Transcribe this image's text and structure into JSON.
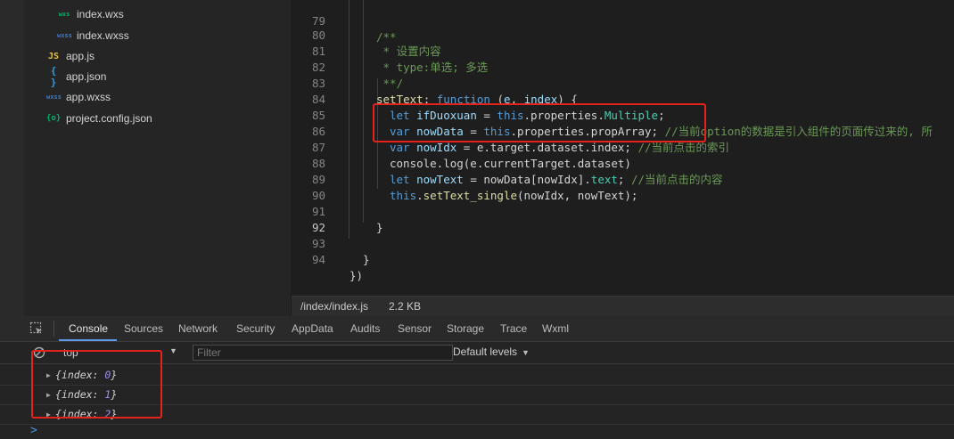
{
  "file_tree": {
    "items": [
      {
        "icon": "wxs-file-icon",
        "icon_text": "wxs",
        "label": "index.wxs"
      },
      {
        "icon": "wxss-file-icon",
        "icon_text": "wxss",
        "label": "index.wxss"
      },
      {
        "icon": "js-file-icon",
        "icon_text": "JS",
        "label": "app.js"
      },
      {
        "icon": "json-file-icon",
        "icon_text": "{ }",
        "label": "app.json"
      },
      {
        "icon": "wxss-file-icon",
        "icon_text": "wxss",
        "label": "app.wxss"
      },
      {
        "icon": "config-file-icon",
        "icon_text": "{o}",
        "label": "project.config.json"
      }
    ]
  },
  "editor": {
    "current_line": 92,
    "lines": [
      {
        "n": 79,
        "code": "/**"
      },
      {
        "n": 80,
        "code": " * 设置内容"
      },
      {
        "n": 81,
        "code": " * type:单选; 多选"
      },
      {
        "n": 82,
        "code": " **/"
      },
      {
        "n": 83,
        "code": "setText: function (e, index) {"
      },
      {
        "n": 84,
        "code": "  let ifDuoxuan = this.properties.Multiple;"
      },
      {
        "n": 85,
        "code": "  var nowData = this.properties.propArray; //当前option的数据是引入组件的页面传过来的, 所"
      },
      {
        "n": 86,
        "code": "  var nowIdx = e.target.dataset.index; //当前点击的索引"
      },
      {
        "n": 87,
        "code": "  console.log(e.currentTarget.dataset)"
      },
      {
        "n": 88,
        "code": "  let nowText = nowData[nowIdx].text; //当前点击的内容"
      },
      {
        "n": 89,
        "code": "  this.setText_single(nowIdx, nowText);"
      },
      {
        "n": 90,
        "code": ""
      },
      {
        "n": 91,
        "code": "}"
      },
      {
        "n": 92,
        "code": ""
      },
      {
        "n": 93,
        "code": "}"
      },
      {
        "n": 94,
        "code": "})"
      }
    ]
  },
  "status_bar": {
    "path": "/index/index.js",
    "size": "2.2 KB"
  },
  "devtools": {
    "tabs": [
      "Console",
      "Sources",
      "Network",
      "Security",
      "AppData",
      "Audits",
      "Sensor",
      "Storage",
      "Trace",
      "Wxml"
    ],
    "active_tab": "Console",
    "toolbar": {
      "context": "top",
      "filter_placeholder": "Filter",
      "levels": "Default levels"
    },
    "logs": [
      {
        "prefix": "{index: ",
        "value": "0",
        "suffix": "}"
      },
      {
        "prefix": "{index: ",
        "value": "1",
        "suffix": "}"
      },
      {
        "prefix": "{index: ",
        "value": "2",
        "suffix": "}"
      }
    ],
    "prompt": ">"
  },
  "colors": {
    "highlight_box": "#e3231c",
    "active_tab_underline": "#5a9ae6",
    "prompt": "#4a8fe0"
  }
}
